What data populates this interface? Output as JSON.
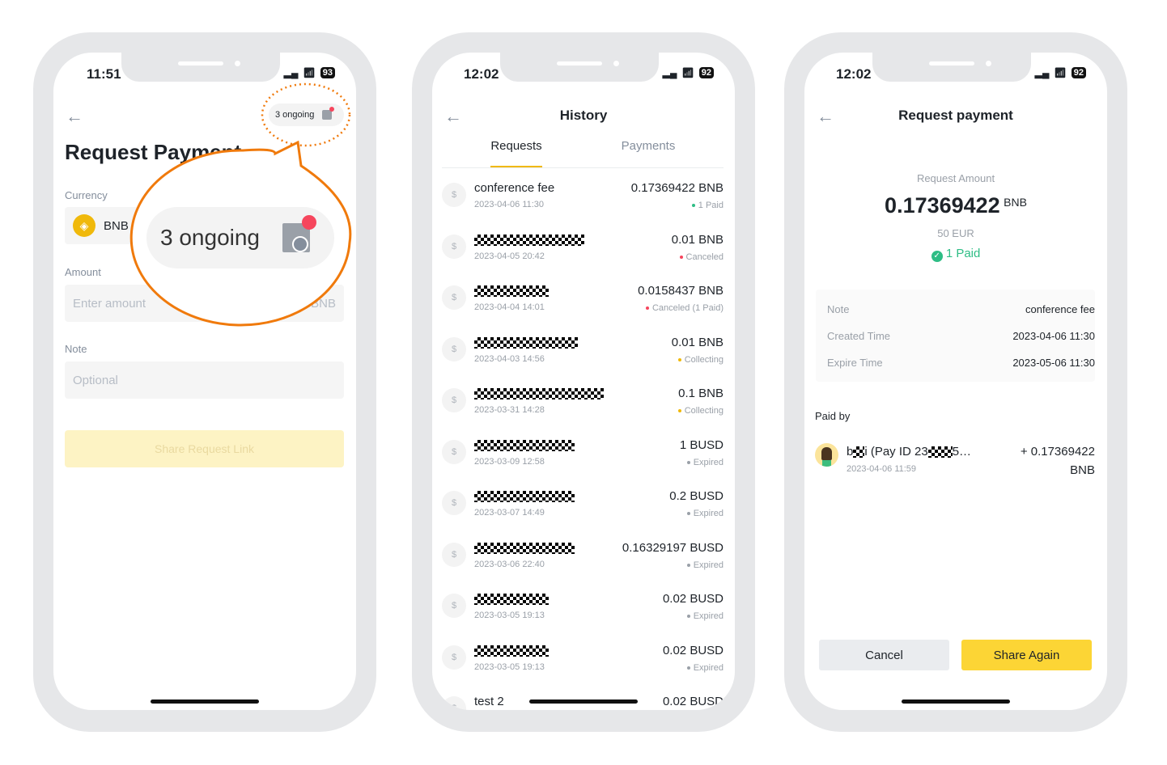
{
  "phone1": {
    "status": {
      "time": "11:51",
      "battery": "93"
    },
    "ongoing_pill": "3 ongoing",
    "title": "Request Payment",
    "currency_label": "Currency",
    "currency_value": "BNB",
    "amount_label": "Amount",
    "amount_placeholder": "Enter amount",
    "amount_suffix": "BNB",
    "note_label": "Note",
    "note_placeholder": "Optional",
    "share_button": "Share Request Link",
    "callout_text": "3 ongoing",
    "callout_color": "#f07a0c"
  },
  "phone2": {
    "status": {
      "time": "12:02",
      "battery": "92"
    },
    "title": "History",
    "tabs": [
      {
        "label": "Requests",
        "active": true
      },
      {
        "label": "Payments",
        "active": false
      }
    ],
    "rows": [
      {
        "name": "conference fee",
        "date": "2023-04-06 11:30",
        "amount": "0.17369422 BNB",
        "status": "1 Paid",
        "status_color": "#2ebd85"
      },
      {
        "name": "",
        "date": "2023-04-05 20:42",
        "amount": "0.01 BNB",
        "status": "Canceled",
        "status_color": "#f6465d"
      },
      {
        "name": "",
        "date": "2023-04-04 14:01",
        "amount": "0.0158437 BNB",
        "status": "Canceled (1 Paid)",
        "status_color": "#f6465d"
      },
      {
        "name": "",
        "date": "2023-04-03 14:56",
        "amount": "0.01 BNB",
        "status": "Collecting",
        "status_color": "#f0b90b"
      },
      {
        "name": "",
        "date": "2023-03-31 14:28",
        "amount": "0.1 BNB",
        "status": "Collecting",
        "status_color": "#f0b90b"
      },
      {
        "name": "",
        "date": "2023-03-09 12:58",
        "amount": "1 BUSD",
        "status": "Expired",
        "status_color": "#9aa0a8"
      },
      {
        "name": "",
        "date": "2023-03-07 14:49",
        "amount": "0.2 BUSD",
        "status": "Expired",
        "status_color": "#9aa0a8"
      },
      {
        "name": "",
        "date": "2023-03-06 22:40",
        "amount": "0.16329197 BUSD",
        "status": "Expired",
        "status_color": "#9aa0a8"
      },
      {
        "name": "",
        "date": "2023-03-05 19:13",
        "amount": "0.02 BUSD",
        "status": "Expired",
        "status_color": "#9aa0a8"
      },
      {
        "name": "",
        "date": "2023-03-05 19:13",
        "amount": "0.02 BUSD",
        "status": "Expired",
        "status_color": "#9aa0a8"
      },
      {
        "name": "test 2",
        "date": "",
        "amount": "0.02 BUSD",
        "status": "",
        "status_color": "#9aa0a8"
      }
    ]
  },
  "phone3": {
    "status": {
      "time": "12:02",
      "battery": "92"
    },
    "title": "Request payment",
    "amount_label": "Request Amount",
    "amount": "0.17369422",
    "amount_unit": "BNB",
    "fiat": "50 EUR",
    "paid_status": "1 Paid",
    "details": [
      {
        "key": "Note",
        "value": "conference fee"
      },
      {
        "key": "Created Time",
        "value": "2023-04-06 11:30"
      },
      {
        "key": "Expire Time",
        "value": "2023-05-06 11:30"
      }
    ],
    "paid_by_label": "Paid by",
    "payer": {
      "name_start": "b",
      "name_mid": "i (Pay ID 23",
      "name_end": "5…",
      "date": "2023-04-06 11:59",
      "amount": "+ 0.17369422",
      "unit": "BNB"
    },
    "cancel_button": "Cancel",
    "share_again_button": "Share Again",
    "accent": "#fcd535",
    "green": "#2ebd85"
  }
}
